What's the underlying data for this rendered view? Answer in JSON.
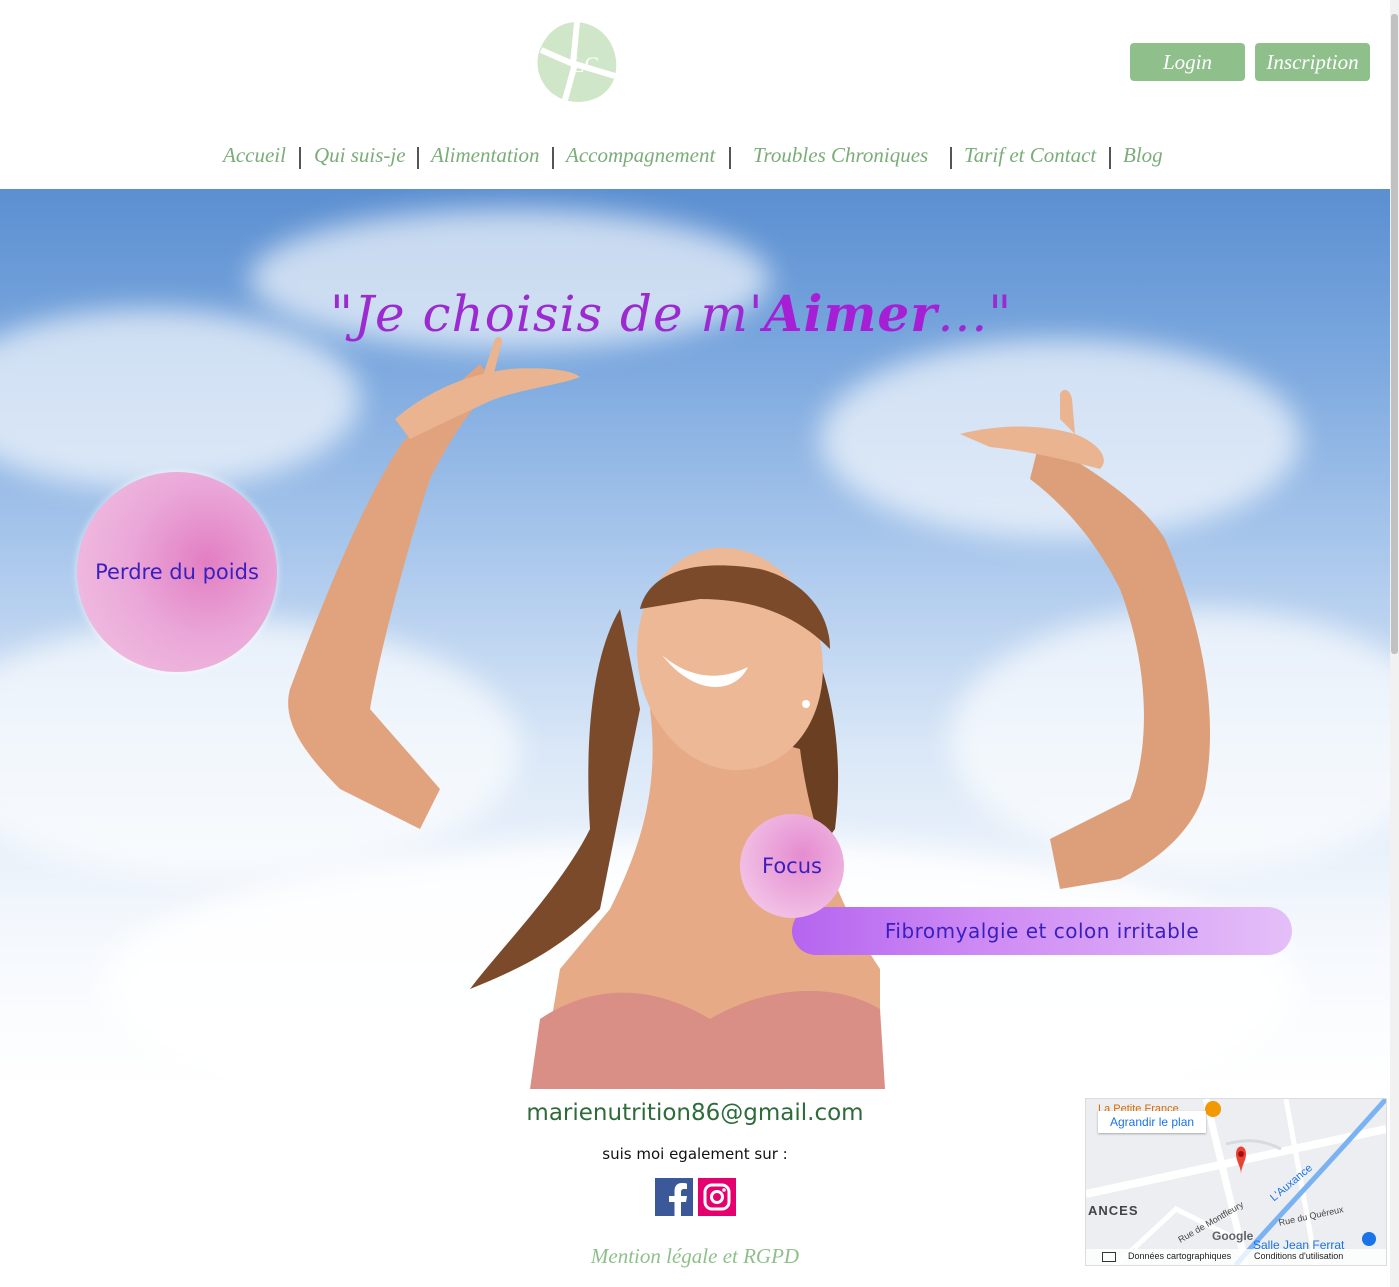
{
  "header": {
    "logo_text": "LC",
    "login_label": "Login",
    "signup_label": "Inscription"
  },
  "nav": {
    "items": [
      "Accueil",
      "Qui suis-je",
      "Alimentation",
      "Accompagnement",
      "Troubles Chroniques",
      "Tarif et Contact",
      "Blog"
    ]
  },
  "hero": {
    "quote_prefix": "\"Je choisis de m'",
    "quote_emphasis": "Aimer",
    "quote_suffix": "...\"",
    "bubble_weight_label": "Perdre du poids",
    "bubble_focus_label": "Focus",
    "pill_label": "Fibromyalgie et colon irritable"
  },
  "footer": {
    "email": "marienutrition86@gmail.com",
    "follow_text": "suis moi egalement sur :",
    "facebook_icon": "facebook-icon",
    "instagram_icon": "instagram-icon",
    "legal_link": "Mention légale et RGPD"
  },
  "map": {
    "enlarge_label": "Agrandir le plan",
    "place_top": "La Petite France",
    "area_label": "ANCES",
    "river_label": "L'Auxance",
    "street1": "Rue de Montfleury",
    "street2": "Rue du Quéreux",
    "place_bottom": "Salle Jean Ferrat",
    "attribution_data": "Données cartographiques",
    "attribution_terms": "Conditions d'utilisation",
    "brand": "Google"
  },
  "colors": {
    "accent_green": "#8fc08b",
    "nav_green": "#7aad77",
    "quote_purple": "#9b2bd0",
    "bubble_text": "#3a1fbf"
  }
}
